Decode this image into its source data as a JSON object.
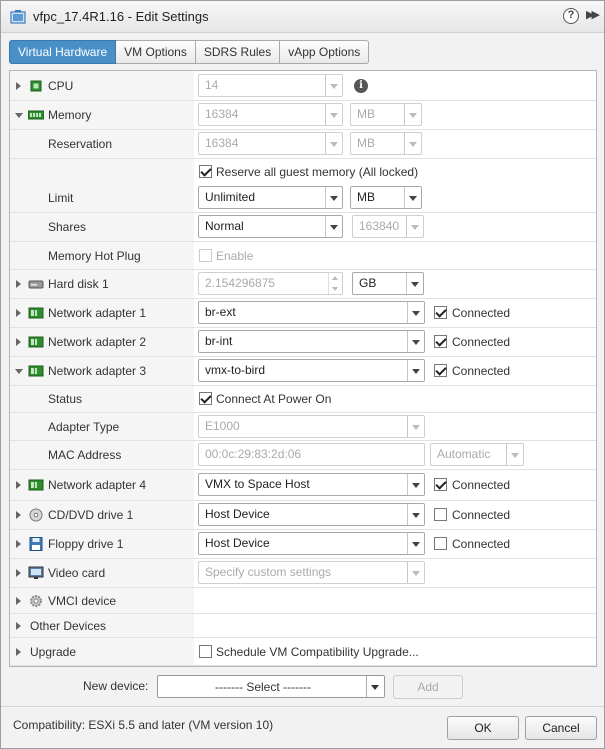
{
  "window": {
    "title": "vfpc_17.4R1.16 - Edit Settings",
    "help_glyph": "?",
    "expand_glyph": "▶▶"
  },
  "tabs": [
    {
      "label": "Virtual Hardware",
      "active": true
    },
    {
      "label": "VM Options"
    },
    {
      "label": "SDRS Rules"
    },
    {
      "label": "vApp Options"
    }
  ],
  "cpu": {
    "label": "CPU",
    "value": "14",
    "info_glyph": "i"
  },
  "memory": {
    "label": "Memory",
    "value": "16384",
    "unit": "MB",
    "reservation_label": "Reservation",
    "reservation_value": "16384",
    "reservation_unit": "MB",
    "reserve_all_label": "Reserve all guest memory (All locked)",
    "reserve_all_checked": true,
    "limit_label": "Limit",
    "limit_value": "Unlimited",
    "limit_unit": "MB",
    "shares_label": "Shares",
    "shares_value": "Normal",
    "shares_number": "163840",
    "hotplug_label": "Memory Hot Plug",
    "hotplug_option": "Enable",
    "hotplug_checked": false
  },
  "hard_disk": {
    "label": "Hard disk 1",
    "value": "2.154296875",
    "unit": "GB"
  },
  "network_adapters": [
    {
      "label": "Network adapter 1",
      "network": "br-ext",
      "connected_label": "Connected",
      "connected": true
    },
    {
      "label": "Network adapter 2",
      "network": "br-int",
      "connected_label": "Connected",
      "connected": true
    },
    {
      "label": "Network adapter 3",
      "network": "vmx-to-bird",
      "connected_label": "Connected",
      "connected": true
    },
    {
      "label": "Network adapter 4",
      "network": "VMX to Space Host",
      "connected_label": "Connected",
      "connected": true
    }
  ],
  "adapter3_details": {
    "status_label": "Status",
    "status_option": "Connect At Power On",
    "status_checked": true,
    "type_label": "Adapter Type",
    "type_value": "E1000",
    "mac_label": "MAC Address",
    "mac_value": "00:0c:29:83:2d:06",
    "mac_mode": "Automatic"
  },
  "cd_dvd": {
    "label": "CD/DVD drive 1",
    "value": "Host Device",
    "connected_label": "Connected",
    "connected": false
  },
  "floppy": {
    "label": "Floppy drive 1",
    "value": "Host Device",
    "connected_label": "Connected",
    "connected": false
  },
  "video_card": {
    "label": "Video card",
    "value": "Specify custom settings"
  },
  "vmci": {
    "label": "VMCI device"
  },
  "other_devices": {
    "label": "Other Devices"
  },
  "upgrade": {
    "label": "Upgrade",
    "option": "Schedule VM Compatibility Upgrade...",
    "checked": false
  },
  "new_device": {
    "label": "New device:",
    "select_value": "------- Select -------",
    "add_label": "Add"
  },
  "footer": {
    "compatibility": "Compatibility: ESXi 5.5 and later (VM version 10)",
    "ok_label": "OK",
    "cancel_label": "Cancel"
  },
  "colors": {
    "tab_active": "#4a90c8",
    "panel_left": "#f5f5f5",
    "network_icon": "#2e8b2e"
  }
}
